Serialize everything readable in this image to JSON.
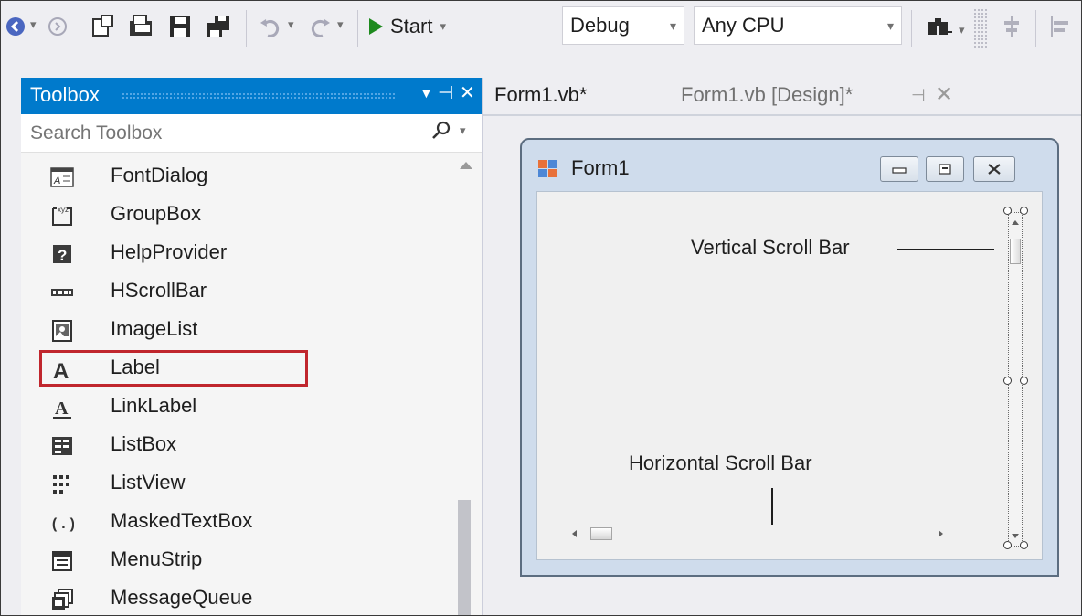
{
  "toolbar": {
    "start_label": "Start",
    "config_value": "Debug",
    "platform_value": "Any CPU"
  },
  "toolbox": {
    "title": "Toolbox",
    "search_placeholder": "Search Toolbox",
    "items": [
      {
        "label": "FontDialog",
        "icon": "font-dialog-icon"
      },
      {
        "label": "GroupBox",
        "icon": "group-box-icon"
      },
      {
        "label": "HelpProvider",
        "icon": "help-provider-icon"
      },
      {
        "label": "HScrollBar",
        "icon": "hscrollbar-icon",
        "highlighted": true
      },
      {
        "label": "ImageList",
        "icon": "image-list-icon"
      },
      {
        "label": "Label",
        "icon": "label-icon"
      },
      {
        "label": "LinkLabel",
        "icon": "link-label-icon"
      },
      {
        "label": "ListBox",
        "icon": "list-box-icon"
      },
      {
        "label": "ListView",
        "icon": "list-view-icon"
      },
      {
        "label": "MaskedTextBox",
        "icon": "masked-textbox-icon"
      },
      {
        "label": "MenuStrip",
        "icon": "menu-strip-icon"
      },
      {
        "label": "MessageQueue",
        "icon": "message-queue-icon"
      }
    ]
  },
  "tabs": {
    "code_tab": "Form1.vb*",
    "design_tab": "Form1.vb [Design]*"
  },
  "designer": {
    "form_title": "Form1",
    "vertical_callout": "Vertical Scroll Bar",
    "horizontal_callout": "Horizontal Scroll Bar"
  },
  "colors": {
    "accent": "#007acc",
    "highlight_border": "#c0262d",
    "start_green": "#1e8a1e"
  }
}
